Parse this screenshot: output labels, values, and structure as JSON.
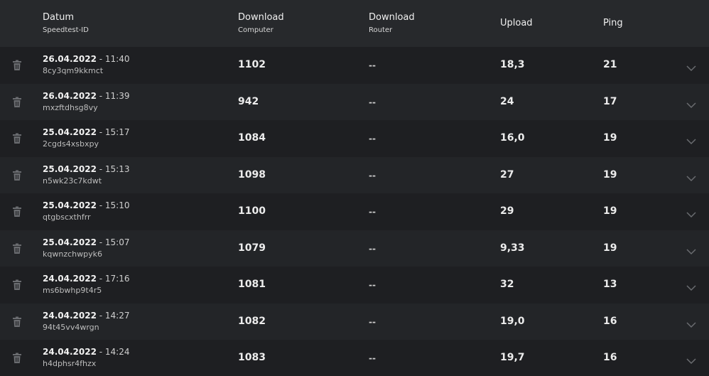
{
  "header": {
    "datum": "Datum",
    "speedtest_id": "Speedtest-ID",
    "download_computer_title": "Download",
    "download_computer_sub": "Computer",
    "download_router_title": "Download",
    "download_router_sub": "Router",
    "upload": "Upload",
    "ping": "Ping"
  },
  "rows": [
    {
      "date": "26.04.2022",
      "time": " - 11:40",
      "id": "8cy3qm9kkmct",
      "download_computer": "1102",
      "download_router": "--",
      "upload": "18,3",
      "ping": "21"
    },
    {
      "date": "26.04.2022",
      "time": " - 11:39",
      "id": "mxzftdhsg8vy",
      "download_computer": "942",
      "download_router": "--",
      "upload": "24",
      "ping": "17"
    },
    {
      "date": "25.04.2022",
      "time": " - 15:17",
      "id": "2cgds4xsbxpy",
      "download_computer": "1084",
      "download_router": "--",
      "upload": "16,0",
      "ping": "19"
    },
    {
      "date": "25.04.2022",
      "time": " - 15:13",
      "id": "n5wk23c7kdwt",
      "download_computer": "1098",
      "download_router": "--",
      "upload": "27",
      "ping": "19"
    },
    {
      "date": "25.04.2022",
      "time": " - 15:10",
      "id": "qtgbscxthfrr",
      "download_computer": "1100",
      "download_router": "--",
      "upload": "29",
      "ping": "19"
    },
    {
      "date": "25.04.2022",
      "time": " - 15:07",
      "id": "kqwnzchwpyk6",
      "download_computer": "1079",
      "download_router": "--",
      "upload": "9,33",
      "ping": "19"
    },
    {
      "date": "24.04.2022",
      "time": " - 17:16",
      "id": "ms6bwhp9t4r5",
      "download_computer": "1081",
      "download_router": "--",
      "upload": "32",
      "ping": "13"
    },
    {
      "date": "24.04.2022",
      "time": " - 14:27",
      "id": "94t45vv4wrgn",
      "download_computer": "1082",
      "download_router": "--",
      "upload": "19,0",
      "ping": "16"
    },
    {
      "date": "24.04.2022",
      "time": " - 14:24",
      "id": "h4dphsr4fhzx",
      "download_computer": "1083",
      "download_router": "--",
      "upload": "19,7",
      "ping": "16"
    }
  ],
  "icons": {
    "delete": "trash-icon",
    "expand": "chevron-down-icon"
  },
  "colors": {
    "header_bg": "#27292c",
    "row_odd_bg": "#1e1f22",
    "row_even_bg": "#232528",
    "icon": "#6a6c70"
  }
}
